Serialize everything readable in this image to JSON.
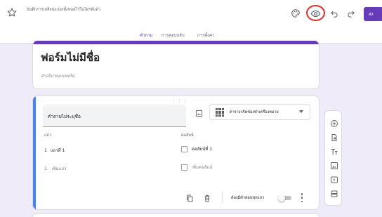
{
  "header": {
    "save_status": "บันทึกการเปลี่ยนแปลงทั้งหมดไว้ในไดรฟ์แล้ว",
    "send_label": "ส่ง",
    "icons": [
      "star-icon",
      "palette-icon",
      "eye-icon",
      "undo-icon",
      "redo-icon"
    ],
    "accent_color": "#673ab7",
    "highlight_color": "#d93025"
  },
  "tabs": [
    {
      "label": "คำถาม",
      "active": true
    },
    {
      "label": "การตอบกลับ",
      "active": false
    },
    {
      "label": "การตั้งค่า",
      "active": false
    }
  ],
  "form": {
    "title": "ฟอร์มไม่มีชื่อ",
    "description_placeholder": "คำอธิบายแบบฟอร์ม"
  },
  "question": {
    "title": "คำถามไม่ระบุชื่อ",
    "type_label": "ตารางกริดช่องทำเครื่องหมาย",
    "rows_header": "แถว",
    "columns_header": "คอลัมน์",
    "rows": [
      {
        "number": "1",
        "label": "แถวที่ 1"
      },
      {
        "number": "2.",
        "label": "เพิ่มแถว"
      }
    ],
    "columns": [
      {
        "label": "คอลัมน์ที่ 1"
      },
      {
        "label": "เพิ่มคอลัมน์"
      }
    ],
    "required_label": "ต้องมีคำตอบทุกแถว",
    "required": false
  },
  "side_toolbar": [
    "add-question-icon",
    "import-questions-icon",
    "add-title-icon",
    "add-image-icon",
    "add-video-icon",
    "add-section-icon"
  ]
}
